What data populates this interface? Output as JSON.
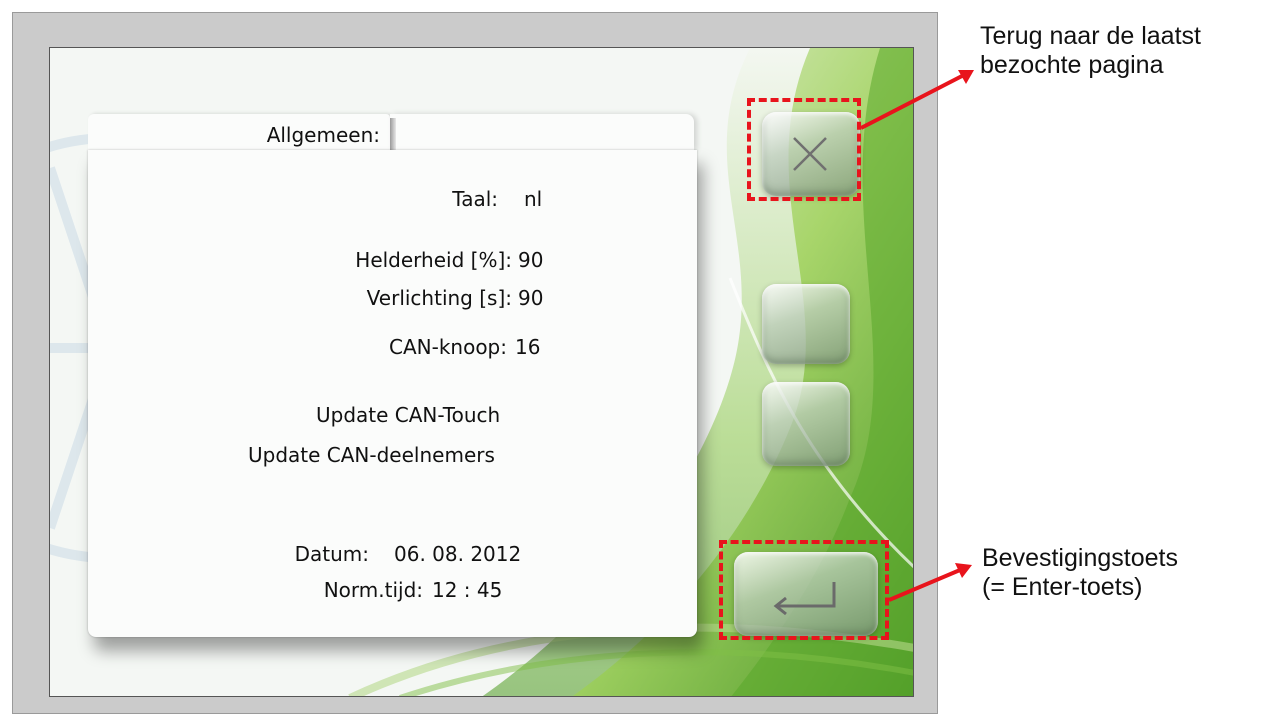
{
  "tab": {
    "label": "Allgemeen:"
  },
  "settings": {
    "taal": {
      "label": "Taal:",
      "value": "nl"
    },
    "helderheid": {
      "label": "Helderheid [%]:",
      "value": "90"
    },
    "verlichting": {
      "label": "Verlichting [s]:",
      "value": "90"
    },
    "can_knoop": {
      "label": "CAN-knoop:",
      "value": "16"
    },
    "update_touch": "Update CAN-Touch",
    "update_deelnemers": "Update CAN-deelnemers",
    "datum": {
      "label": "Datum:",
      "value": "06. 08. 2012"
    },
    "normtijd": {
      "label": "Norm.tijd:",
      "value": "12 : 45"
    }
  },
  "buttons": {
    "close_icon": "close-icon",
    "enter_icon": "enter-icon"
  },
  "annotations": {
    "close_line1": "Terug naar de laatst",
    "close_line2": "bezochte pagina",
    "enter_line1": "Bevestigingstoets",
    "enter_line2": "(= Enter-toets)"
  },
  "colors": {
    "highlight": "#e8141c",
    "frame": "#cbcbcb",
    "accent_green": "#6fb52a"
  }
}
